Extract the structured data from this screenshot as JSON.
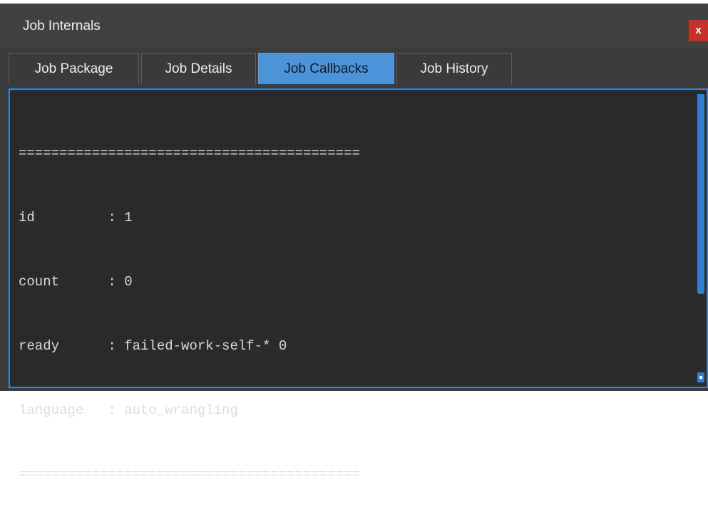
{
  "window": {
    "title": "Job Internals",
    "close_label": "x"
  },
  "tabs": [
    {
      "label": "Job Package",
      "active": false
    },
    {
      "label": "Job Details",
      "active": false
    },
    {
      "label": "Job Callbacks",
      "active": true
    },
    {
      "label": "Job History",
      "active": false
    }
  ],
  "log": {
    "lines": [
      "==========================================",
      "id         : 1",
      "count      : 0",
      "ready      : failed-work-self-* 0",
      "language   : auto_wrangling",
      "=========================================="
    ]
  },
  "colors": {
    "window_bg": "#3b3b3b",
    "active_tab": "#4c93d8",
    "content_border": "#3d86cf",
    "close_button": "#c9302c",
    "scrollbar": "#2f7fd6"
  }
}
